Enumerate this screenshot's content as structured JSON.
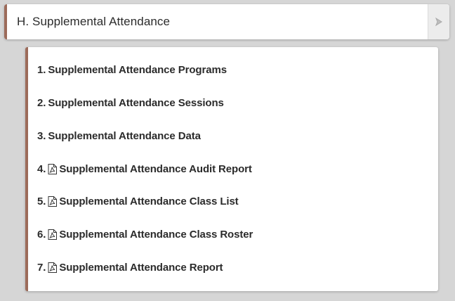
{
  "section": {
    "title": "H. Supplemental Attendance",
    "expand_icon": "chevron-right-icon"
  },
  "colors": {
    "accent_border": "#9c6b5a",
    "background": "#d6d6d6"
  },
  "items": [
    {
      "num": "1.",
      "label": "Supplemental Attendance Programs",
      "icon": null
    },
    {
      "num": "2.",
      "label": "Supplemental Attendance Sessions",
      "icon": null
    },
    {
      "num": "3.",
      "label": "Supplemental Attendance Data",
      "icon": null
    },
    {
      "num": "4.",
      "label": "Supplemental Attendance Audit Report",
      "icon": "pdf-file-icon"
    },
    {
      "num": "5.",
      "label": "Supplemental Attendance Class List",
      "icon": "pdf-file-icon"
    },
    {
      "num": "6.",
      "label": "Supplemental Attendance Class Roster",
      "icon": "pdf-file-icon"
    },
    {
      "num": "7.",
      "label": "Supplemental Attendance Report",
      "icon": "pdf-file-icon"
    }
  ]
}
